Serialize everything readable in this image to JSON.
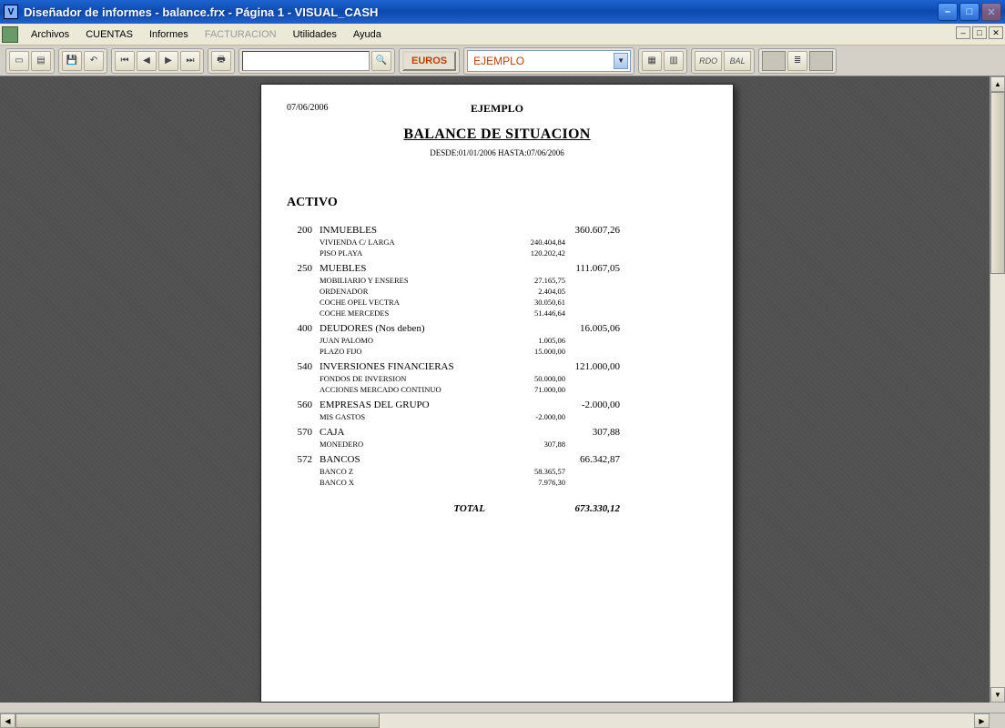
{
  "window": {
    "title": "Diseñador de informes - balance.frx - Página 1 - VISUAL_CASH"
  },
  "menu": {
    "items": [
      {
        "label": "Archivos",
        "disabled": false
      },
      {
        "label": "CUENTAS",
        "disabled": false
      },
      {
        "label": "Informes",
        "disabled": false
      },
      {
        "label": "FACTURACION",
        "disabled": true
      },
      {
        "label": "Utilidades",
        "disabled": false
      },
      {
        "label": "Ayuda",
        "disabled": false
      }
    ]
  },
  "toolbar": {
    "euros_label": "EUROS",
    "select_value": "EJEMPLO",
    "rdo_label": "RDO",
    "bal_label": "BAL"
  },
  "report": {
    "date": "07/06/2006",
    "company": "EJEMPLO",
    "title": "BALANCE DE SITUACION",
    "range": "DESDE:01/01/2006 HASTA:07/06/2006",
    "section": "ACTIVO",
    "accounts": [
      {
        "code": "200",
        "name": "INMUEBLES",
        "amount": "360.607,26",
        "subs": [
          {
            "name": "VIVIENDA C/ LARGA",
            "amount": "240.404,84"
          },
          {
            "name": "PISO PLAYA",
            "amount": "120.202,42"
          }
        ]
      },
      {
        "code": "250",
        "name": "MUEBLES",
        "amount": "111.067,05",
        "subs": [
          {
            "name": "MOBILIARIO Y ENSERES",
            "amount": "27.165,75"
          },
          {
            "name": "ORDENADOR",
            "amount": "2.404,05"
          },
          {
            "name": "COCHE OPEL VECTRA",
            "amount": "30.050,61"
          },
          {
            "name": "COCHE MERCEDES",
            "amount": "51.446,64"
          }
        ]
      },
      {
        "code": "400",
        "name": "DEUDORES (Nos deben)",
        "amount": "16.005,06",
        "subs": [
          {
            "name": "JUAN PALOMO",
            "amount": "1.005,06"
          },
          {
            "name": "PLAZO FIJO",
            "amount": "15.000,00"
          }
        ]
      },
      {
        "code": "540",
        "name": "INVERSIONES FINANCIERAS",
        "amount": "121.000,00",
        "subs": [
          {
            "name": "FONDOS DE INVERSION",
            "amount": "50.000,00"
          },
          {
            "name": "ACCIONES MERCADO CONTINUO",
            "amount": "71.000,00"
          }
        ]
      },
      {
        "code": "560",
        "name": "EMPRESAS DEL GRUPO",
        "amount": "-2.000,00",
        "subs": [
          {
            "name": "MIS GASTOS",
            "amount": "-2.000,00"
          }
        ]
      },
      {
        "code": "570",
        "name": "CAJA",
        "amount": "307,88",
        "subs": [
          {
            "name": "MONEDERO",
            "amount": "307,88"
          }
        ]
      },
      {
        "code": "572",
        "name": "BANCOS",
        "amount": "66.342,87",
        "subs": [
          {
            "name": "BANCO Z",
            "amount": "58.365,57"
          },
          {
            "name": "BANCO X",
            "amount": "7.976,30"
          }
        ]
      }
    ],
    "total_label": "TOTAL",
    "total_amount": "673.330,12"
  }
}
